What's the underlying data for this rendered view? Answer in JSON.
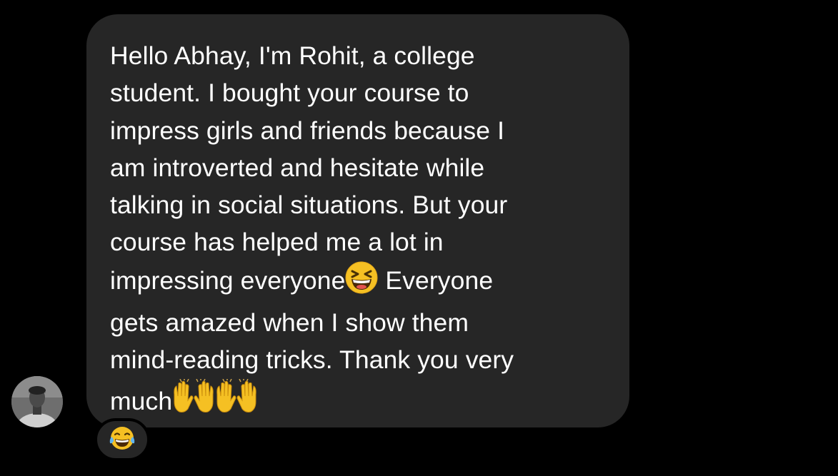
{
  "message": {
    "lines": [
      "Hello Abhay, I'm Rohit, a college",
      "student. I bought your course to",
      "impress girls and friends because I",
      "am introverted and hesitate while",
      "talking in social situations. But your",
      "course has helped me a lot in",
      "impressing everyone",
      " Everyone",
      "gets amazed when I show them",
      "mind-reading tricks. Thank you very",
      "much"
    ],
    "inline_emojis": [
      "grinning-squinting-face",
      "raising-hands",
      "raising-hands"
    ]
  },
  "reaction": {
    "emoji": "face-with-tears-of-joy"
  },
  "sender": {
    "avatar": "profile-photo"
  },
  "colors": {
    "background": "#000000",
    "bubble": "#262626",
    "text": "#ffffff",
    "emoji_yellow": "#f5c023"
  }
}
